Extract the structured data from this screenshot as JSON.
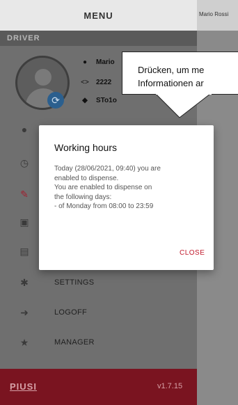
{
  "background": {
    "user_name": "Mario Rossi"
  },
  "drawer": {
    "title": "MENU",
    "section_label": "DRIVER",
    "profile": {
      "name": "Mario",
      "code": "2222",
      "station": "STo1o"
    },
    "items": [
      {
        "label": "",
        "icon": "drop-icon"
      },
      {
        "label": "",
        "icon": "clock-icon"
      },
      {
        "label": "",
        "icon": "nozzle-icon"
      },
      {
        "label": "",
        "icon": "fuel-pump-icon"
      },
      {
        "label": "",
        "icon": "receipt-icon"
      },
      {
        "label": "SETTINGS",
        "icon": "gear-icon"
      },
      {
        "label": "LOGOFF",
        "icon": "logout-icon"
      },
      {
        "label": "MANAGER",
        "icon": "star-icon"
      }
    ],
    "footer": {
      "logo": "PIUSI",
      "version": "v1.7.15"
    }
  },
  "tooltip": {
    "line1": "Drücken, um me",
    "line2": "Informationen ar"
  },
  "dialog": {
    "title": "Working hours",
    "body_lines": [
      "Today (28/06/2021, 09:40) you are",
      "enabled to dispense.",
      "You are enabled to dispense on",
      "the following days:",
      "- of Monday from 08:00 to 23:59"
    ],
    "close_label": "CLOSE"
  },
  "colors": {
    "accent": "#c0182a",
    "footer": "#7a1420",
    "badge": "#2b5f8e"
  }
}
